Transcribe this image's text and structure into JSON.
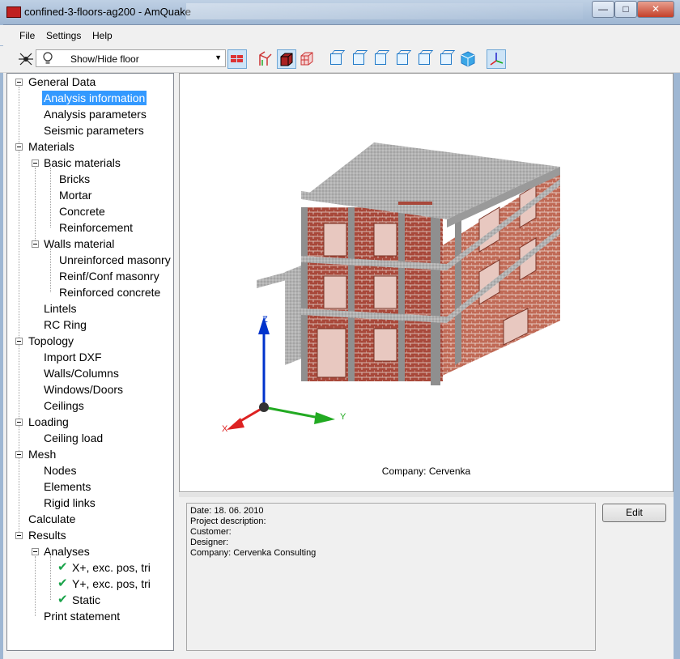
{
  "window": {
    "title": "confined-3-floors-ag200 - AmQuake",
    "minimize": "—",
    "maximize": "□",
    "close": "✕"
  },
  "menu": [
    "File",
    "Settings",
    "Help"
  ],
  "toolbar": {
    "floor_combo_value": "Show/Hide floor"
  },
  "tree": {
    "items": [
      {
        "label": "General Data"
      },
      {
        "label": "Analysis information"
      },
      {
        "label": "Analysis parameters"
      },
      {
        "label": "Seismic parameters"
      },
      {
        "label": "Materials"
      },
      {
        "label": "Basic materials"
      },
      {
        "label": "Bricks"
      },
      {
        "label": "Mortar"
      },
      {
        "label": "Concrete"
      },
      {
        "label": "Reinforcement"
      },
      {
        "label": "Walls material"
      },
      {
        "label": "Unreinforced masonry"
      },
      {
        "label": "Reinf/Conf masonry"
      },
      {
        "label": "Reinforced concrete"
      },
      {
        "label": "Lintels"
      },
      {
        "label": "RC Ring"
      },
      {
        "label": "Topology"
      },
      {
        "label": "Import DXF"
      },
      {
        "label": "Walls/Columns"
      },
      {
        "label": "Windows/Doors"
      },
      {
        "label": "Ceilings"
      },
      {
        "label": "Loading"
      },
      {
        "label": "Ceiling load"
      },
      {
        "label": "Mesh"
      },
      {
        "label": "Nodes"
      },
      {
        "label": "Elements"
      },
      {
        "label": "Rigid links"
      },
      {
        "label": "Calculate"
      },
      {
        "label": "Results"
      },
      {
        "label": "Analyses"
      },
      {
        "label": "X+, exc. pos, tri"
      },
      {
        "label": "Y+, exc. pos, tri"
      },
      {
        "label": "Static"
      },
      {
        "label": "Print statement"
      }
    ]
  },
  "view": {
    "axis_x": "X",
    "axis_y": "Y",
    "axis_z": "Z",
    "company": "Company: Cervenka"
  },
  "info": {
    "lines": [
      "Date: 18. 06. 2010",
      "Project description:",
      "Customer:",
      "Designer:",
      "Company: Cervenka Consulting"
    ]
  },
  "buttons": {
    "edit": "Edit"
  },
  "colors": {
    "selection": "#3399ff",
    "brick": "#a8483a",
    "slab": "#a9a9a9",
    "toolbar_cube": "#1e78c8"
  }
}
